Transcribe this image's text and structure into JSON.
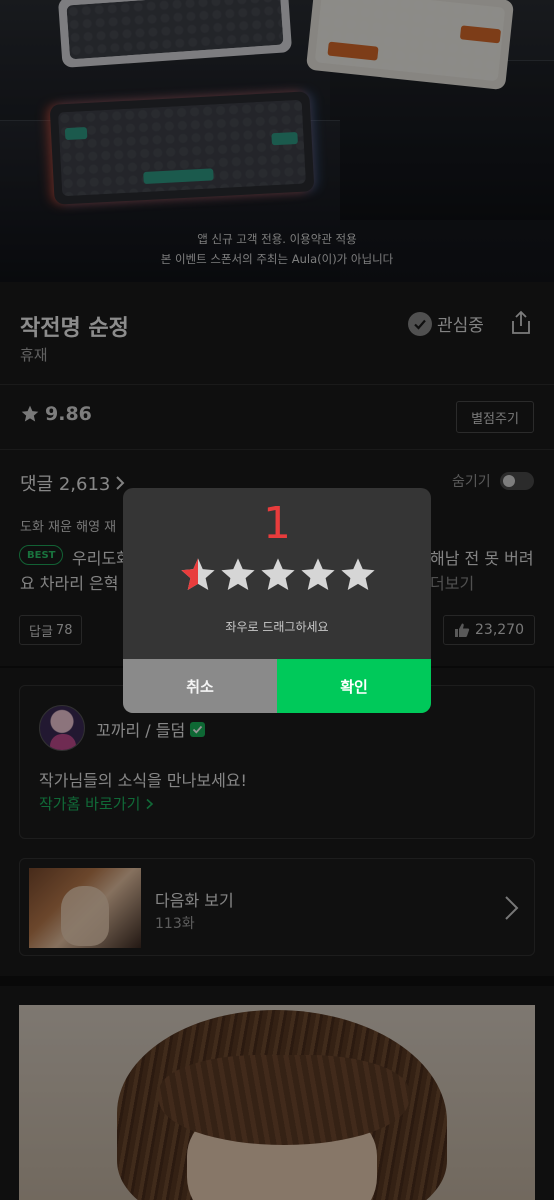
{
  "banner": {
    "line1": "앱 신규 고객 전용. 이용약관 적용",
    "line2": "본 이벤트 스폰서의 주최는 Aula(이)가 아닙니다"
  },
  "header": {
    "title": "작전명 순정",
    "status": "휴재",
    "watch_label": "관심중"
  },
  "rating": {
    "value": "9.86",
    "rate_button": "별점주기"
  },
  "comments": {
    "title": "댓글 2,613",
    "hide_label": "숨기기",
    "best_badge": "BEST",
    "author": "도화 재윤 해영 재",
    "text_line1": "우리도화",
    "text_line1_right": "해남 전 못 버려",
    "text_line2": "요 차라리 은혁",
    "more": "더보기",
    "reply_label": "답글",
    "reply_count": "78",
    "like_count": "23,270"
  },
  "author_card": {
    "name": "꼬까리 / 들덤",
    "message": "작가님들의 소식을 만나보세요!",
    "link": "작가홈 바로가기"
  },
  "next_episode": {
    "title": "다음화 보기",
    "episode": "113화"
  },
  "modal": {
    "score": "1",
    "stars": 0.5,
    "hint": "좌우로 드래그하세요",
    "cancel": "취소",
    "confirm": "확인",
    "star_color": "#e83c3c",
    "confirm_color": "#00c95a"
  }
}
